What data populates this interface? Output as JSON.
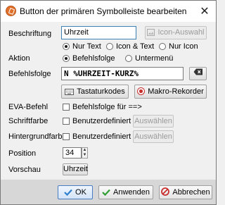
{
  "window": {
    "title": "Button der primären Symbolleiste bearbeiten",
    "close_glyph": "✕"
  },
  "form": {
    "beschriftung_label": "Beschriftung",
    "beschriftung_value": "Uhrzeit",
    "icon_auswahl_label": "Icon-Auswahl",
    "display_options": [
      "Nur Text",
      "Icon & Text",
      "Nur Icon"
    ],
    "display_selected": "Nur Text",
    "aktion_label": "Aktion",
    "aktion_options": [
      "Befehlsfolge",
      "Untermenü"
    ],
    "aktion_selected": "Befehlsfolge",
    "befehlsfolge_label": "Befehlsfolge",
    "befehlsfolge_value": "N %UHRZEIT-KURZ%",
    "tastaturkodes_label": "Tastaturkodes",
    "makro_rekorder_label": "Makro-Rekorder",
    "eva_befehl_label": "EVA-Befehl",
    "eva_checkbox_label": "Befehlsfolge für ==>",
    "schriftfarbe_label": "Schriftfarbe",
    "schriftfarbe_checkbox_label": "Benutzerdefiniert",
    "schriftfarbe_auswaehlen": "Auswählen",
    "hintergrundfarbe_label": "Hintergrundfarbe",
    "hintergrundfarbe_checkbox_label": "Benutzerdefiniert",
    "hintergrundfarbe_auswaehlen": "Auswählen",
    "position_label": "Position",
    "position_value": "34",
    "vorschau_label": "Vorschau",
    "vorschau_button_label": "Uhrzeit"
  },
  "footer": {
    "ok_label": "OK",
    "anwenden_label": "Anwenden",
    "abbrechen_label": "Abbrechen"
  },
  "colors": {
    "accent": "#3c7fb1",
    "ok_check": "#2f7fd0",
    "apply_check": "#2f9e2f",
    "cancel_red": "#c83030"
  }
}
